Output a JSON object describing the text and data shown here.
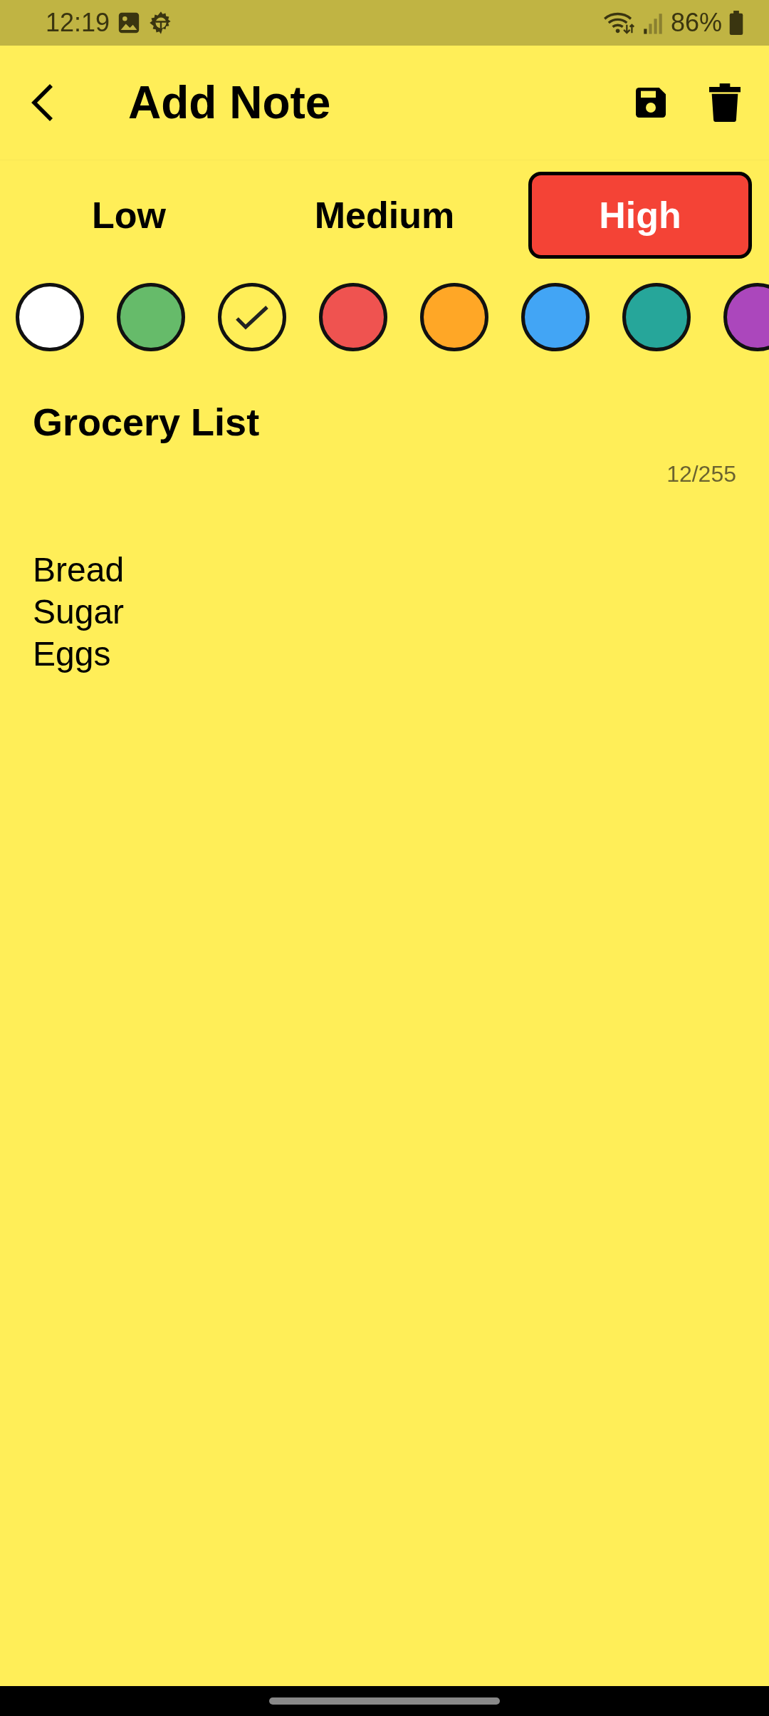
{
  "status_bar": {
    "time": "12:19",
    "battery": "86%"
  },
  "app_bar": {
    "title": "Add Note"
  },
  "priorities": [
    {
      "label": "Low",
      "selected": false
    },
    {
      "label": "Medium",
      "selected": false
    },
    {
      "label": "High",
      "selected": true
    }
  ],
  "colors": [
    {
      "color": "#ffffff",
      "selected": false
    },
    {
      "color": "#66bb6a",
      "selected": false
    },
    {
      "color": "#ffee58",
      "selected": true
    },
    {
      "color": "#ef5350",
      "selected": false
    },
    {
      "color": "#ffa726",
      "selected": false
    },
    {
      "color": "#42a5f5",
      "selected": false
    },
    {
      "color": "#26a69a",
      "selected": false
    },
    {
      "color": "#ab47bc",
      "selected": false
    }
  ],
  "note": {
    "title": "Grocery List",
    "counter": "12/255",
    "body": "Bread\nSugar\nEggs"
  }
}
